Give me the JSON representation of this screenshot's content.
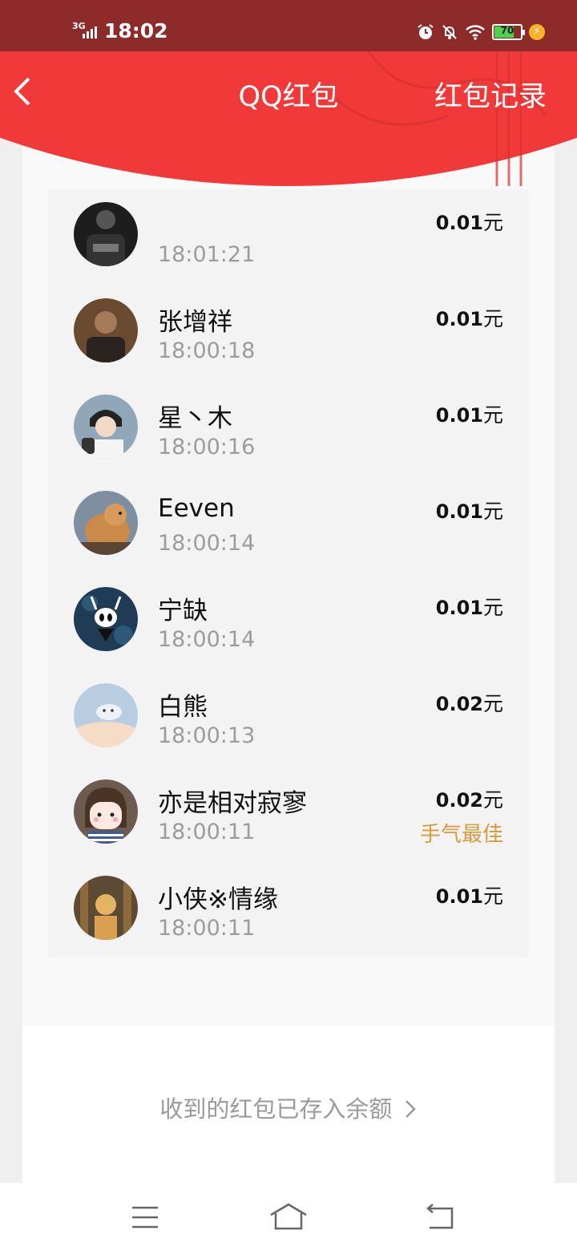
{
  "status_bar": {
    "network": "3G",
    "time": "18:02",
    "battery": "70",
    "icons": [
      "alarm-icon",
      "mute-icon",
      "wifi-icon",
      "battery-icon",
      "charging-icon"
    ]
  },
  "header": {
    "back_icon": "chevron-left-icon",
    "title": "QQ红包",
    "records_label": "红包记录"
  },
  "records": [
    {
      "name": "",
      "time": "18:01:21",
      "amount": "0.01",
      "unit": "元",
      "best": "",
      "avatar_color": "#1d1d1d"
    },
    {
      "name": "张增祥",
      "time": "18:00:18",
      "amount": "0.01",
      "unit": "元",
      "best": "",
      "avatar_color": "#6b4a32"
    },
    {
      "name": "星丶木",
      "time": "18:00:16",
      "amount": "0.01",
      "unit": "元",
      "best": "",
      "avatar_color": "#8fa7b8"
    },
    {
      "name": "Eeven",
      "time": "18:00:14",
      "amount": "0.01",
      "unit": "元",
      "best": "",
      "avatar_color": "#c98a4a"
    },
    {
      "name": "宁缺",
      "time": "18:00:14",
      "amount": "0.01",
      "unit": "元",
      "best": "",
      "avatar_color": "#1f3b55"
    },
    {
      "name": "白熊",
      "time": "18:00:13",
      "amount": "0.02",
      "unit": "元",
      "best": "",
      "avatar_color": "#b9cde0"
    },
    {
      "name": "亦是相对寂寥",
      "time": "18:00:11",
      "amount": "0.02",
      "unit": "元",
      "best": "手气最佳",
      "avatar_color": "#6e5b4f"
    },
    {
      "name": "小侠※情缘",
      "time": "18:00:11",
      "amount": "0.01",
      "unit": "元",
      "best": "",
      "avatar_color": "#8c6a3c"
    }
  ],
  "footer": {
    "balance_link": "收到的红包已存入余额"
  },
  "nav_bar": {
    "icons": [
      "menu-icon",
      "home-icon",
      "back-icon"
    ]
  },
  "colors": {
    "header_red": "#f2393a",
    "status_bar": "#8d2b2b",
    "best_luck": "#d79a3c"
  }
}
